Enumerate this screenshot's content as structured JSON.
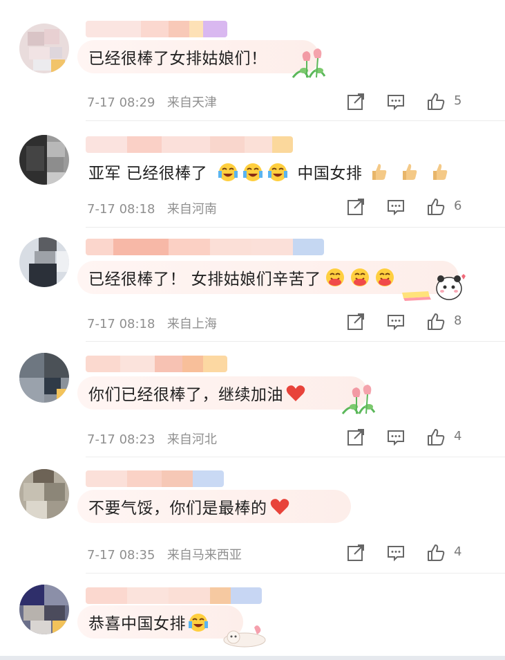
{
  "colors": {
    "bubble_bg": "#fdeeea",
    "meta_text": "#8f8f8f",
    "heart": "#e8433a",
    "icon_stroke": "#666666"
  },
  "comments": [
    {
      "text_parts": [
        "已经很棒了女排姑娘们！"
      ],
      "emojis": [],
      "sticker": "tulip-sticker",
      "date": "7-17 08:29",
      "location": "来自天津",
      "likes": "5"
    },
    {
      "text_parts": [
        "亚军 已经很棒了",
        "中国女排"
      ],
      "emojis": [
        "crying-laugh-emoji",
        "crying-laugh-emoji",
        "crying-laugh-emoji"
      ],
      "thumbs": [
        "thumbs-up-emoji",
        "thumbs-up-emoji",
        "thumbs-up-emoji"
      ],
      "sticker": "",
      "date": "7-17 08:18",
      "location": "来自河南",
      "likes": "6"
    },
    {
      "text_parts": [
        "已经很棒了！ 女排姑娘们辛苦了"
      ],
      "emojis": [
        "hug-emoji",
        "hug-emoji",
        "hug-emoji"
      ],
      "sticker": "panda-sticker",
      "date": "7-17 08:18",
      "location": "来自上海",
      "likes": "8"
    },
    {
      "text_parts": [
        "你们已经很棒了，继续加油"
      ],
      "emojis": [
        "heart-emoji"
      ],
      "sticker": "tulip-sticker",
      "date": "7-17 08:23",
      "location": "来自河北",
      "likes": "4"
    },
    {
      "text_parts": [
        "不要气馁，你们是最棒的"
      ],
      "emojis": [
        "heart-emoji"
      ],
      "sticker": "",
      "date": "7-17 08:35",
      "location": "来自马来西亚",
      "likes": "4"
    },
    {
      "text_parts": [
        "恭喜中国女排"
      ],
      "emojis": [
        "crying-laugh-emoji"
      ],
      "sticker": "cat-sticker",
      "date": "",
      "location": "",
      "likes": ""
    }
  ]
}
